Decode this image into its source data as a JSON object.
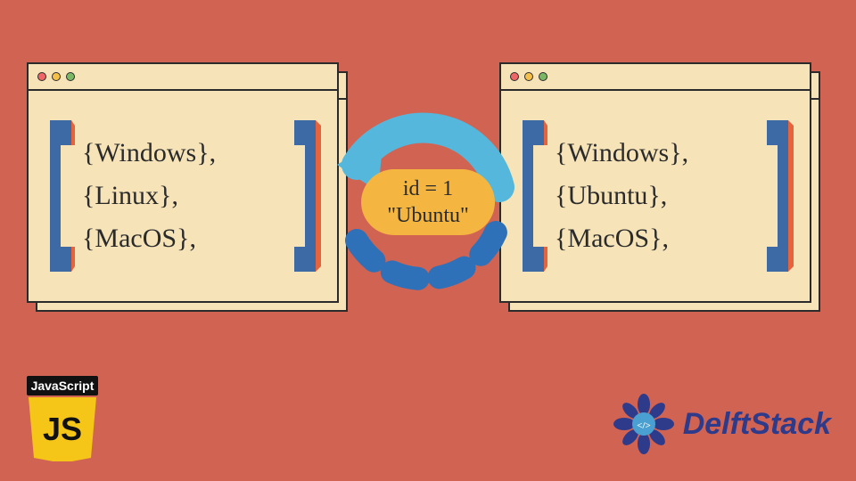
{
  "left_window": {
    "items": [
      "{Windows},",
      "{Linux},",
      "{MacOS},"
    ]
  },
  "right_window": {
    "items": [
      "{Windows},",
      "{Ubuntu},",
      "{MacOS},"
    ]
  },
  "transform": {
    "line1": "id = 1",
    "line2": "\"Ubuntu\""
  },
  "logos": {
    "js_text": "JavaScript",
    "js_badge": "JS",
    "brand": "DelftStack"
  },
  "colors": {
    "bg": "#d16352",
    "window_fill": "#f6e4b8",
    "bracket_blue": "#3d6aa4",
    "bracket_side": "#e7633c",
    "pill": "#f4b640",
    "arrow_light": "#55b7dc",
    "arrow_dark": "#2e71b8",
    "js_yellow": "#f5c518",
    "brand_blue": "#2e3a8a"
  }
}
